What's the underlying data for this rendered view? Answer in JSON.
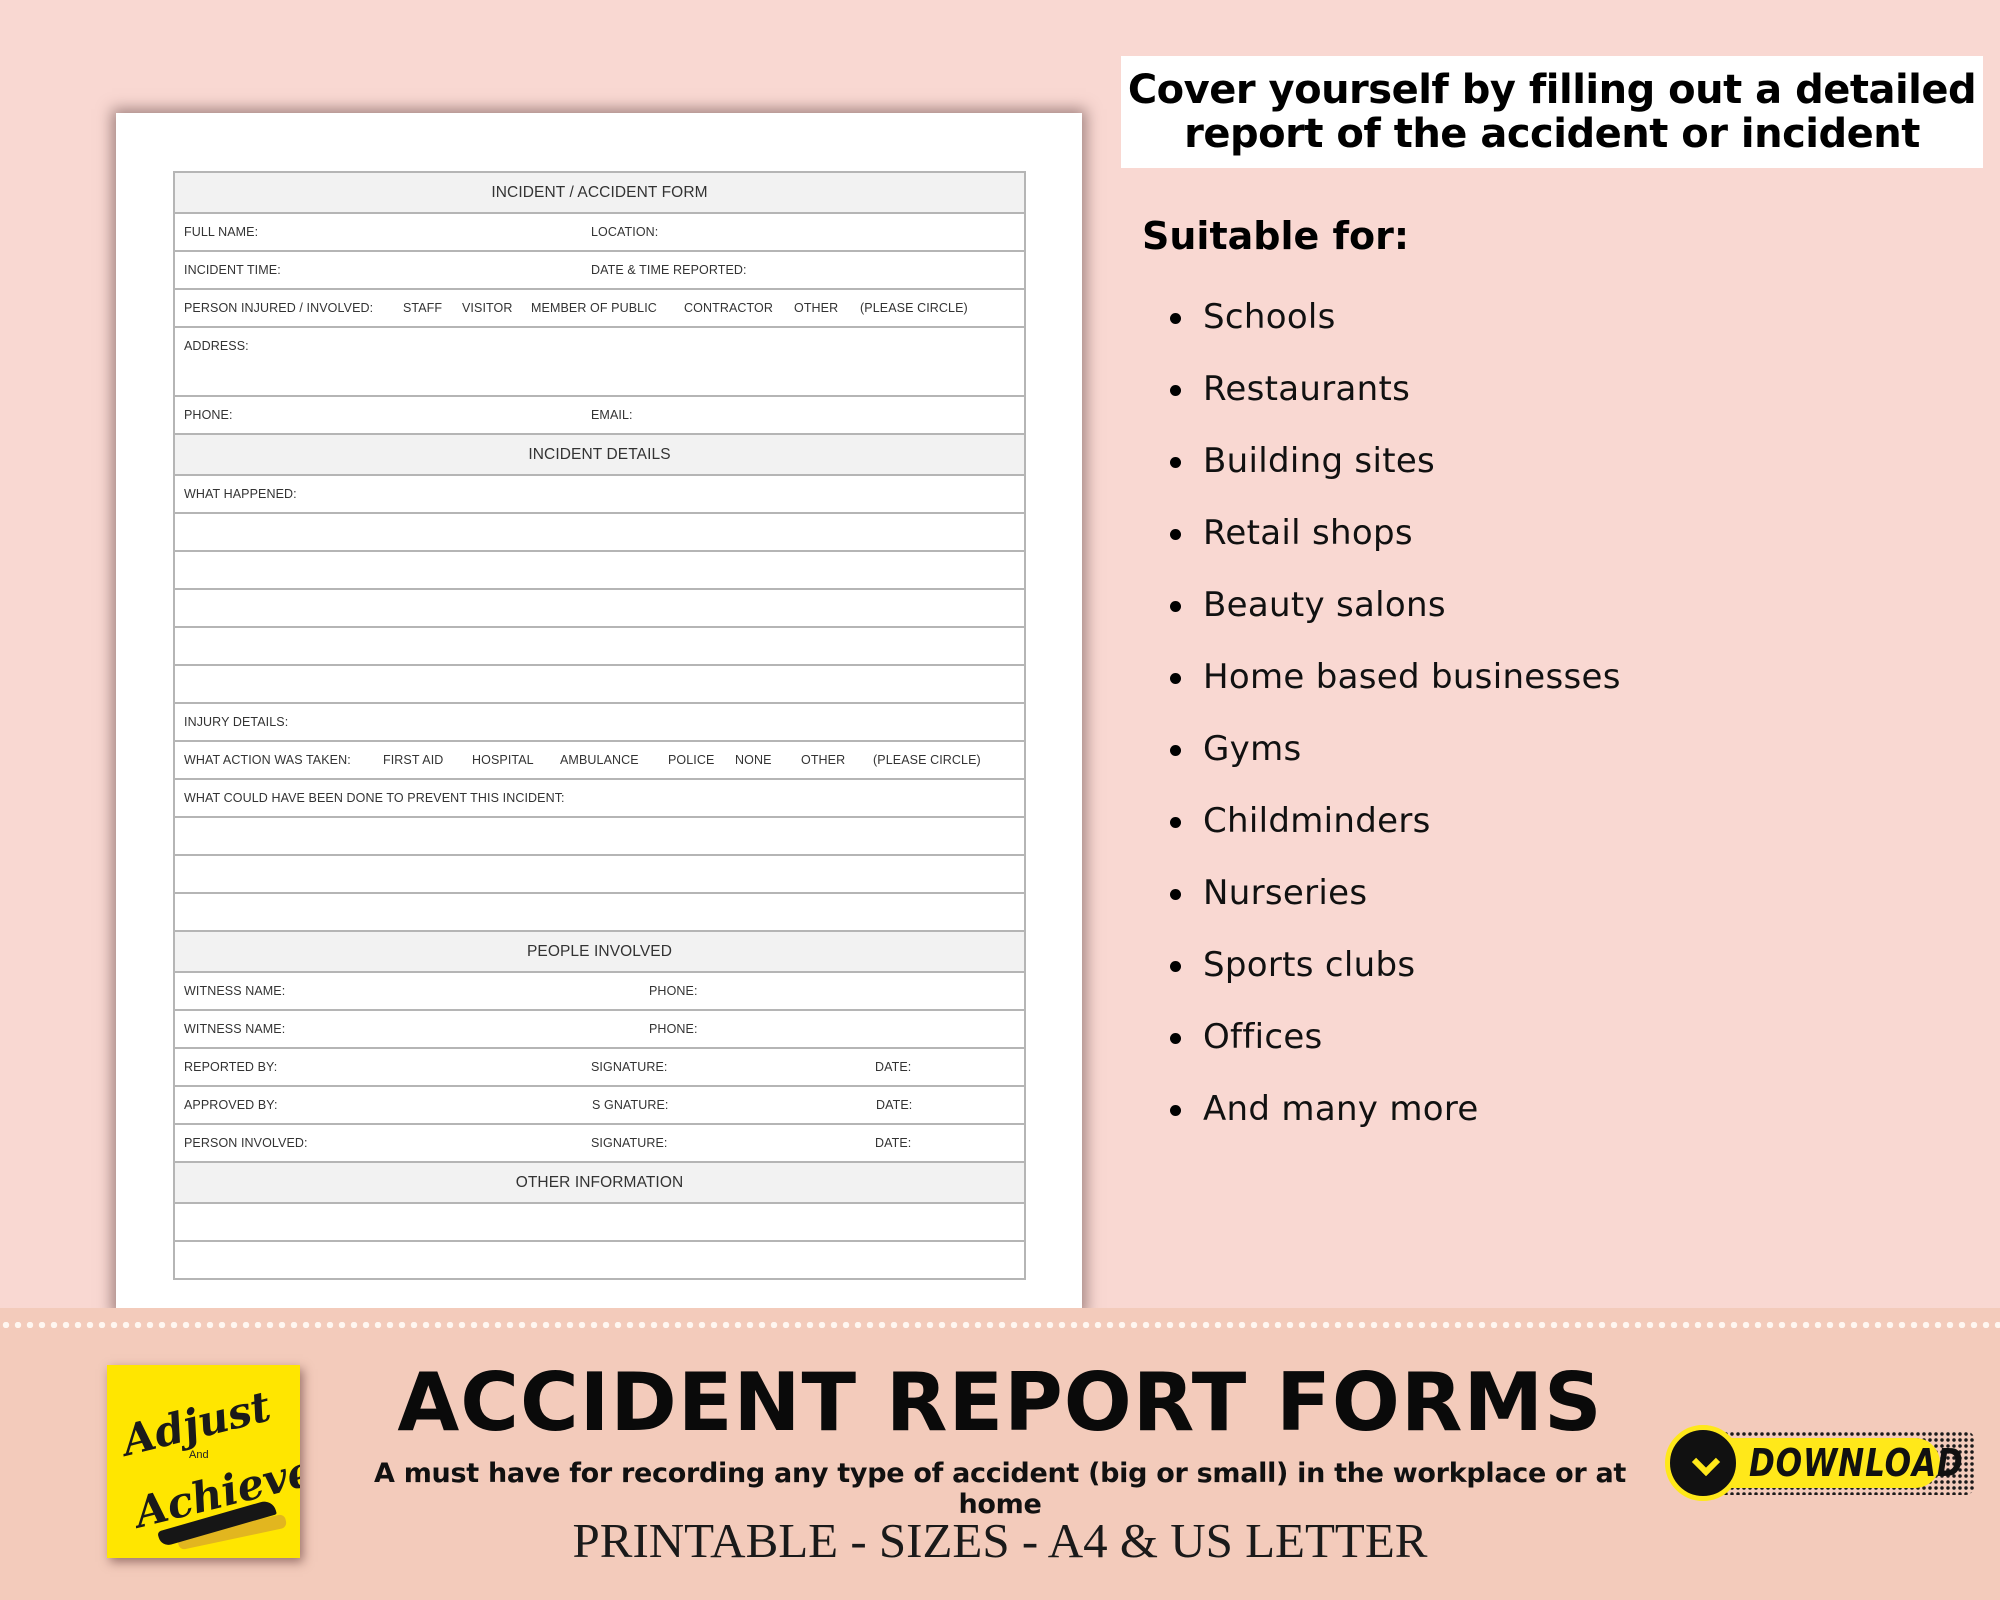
{
  "form": {
    "title": "INCIDENT / ACCIDENT FORM",
    "full_name_label": "FULL NAME:",
    "location_label": "LOCATION:",
    "incident_time_label": "INCIDENT TIME:",
    "date_time_reported_label": "DATE & TIME REPORTED:",
    "person_injured_label": "PERSON INJURED / INVOLVED:",
    "person_options": [
      "STAFF",
      "VISITOR",
      "MEMBER OF PUBLIC",
      "CONTRACTOR",
      "OTHER",
      "(PLEASE CIRCLE)"
    ],
    "address_label": "ADDRESS:",
    "phone_label": "PHONE:",
    "email_label": "EMAIL:",
    "incident_details_header": "INCIDENT DETAILS",
    "what_happened_label": "WHAT HAPPENED:",
    "injury_details_label": "INJURY DETAILS:",
    "action_taken_label": "WHAT ACTION WAS TAKEN:",
    "action_options": [
      "FIRST AID",
      "HOSPITAL",
      "AMBULANCE",
      "POLICE",
      "NONE",
      "OTHER",
      "(PLEASE CIRCLE)"
    ],
    "prevent_label": "WHAT COULD HAVE BEEN DONE TO PREVENT THIS INCIDENT:",
    "people_involved_header": "PEOPLE INVOLVED",
    "witness_name_label": "WITNESS NAME:",
    "witness_phone_label": "PHONE:",
    "reported_by_label": "REPORTED BY:",
    "approved_by_label": "APPROVED BY:",
    "person_involved_label": "PERSON INVOLVED:",
    "signature_label": "SIGNATURE:",
    "signature_label_approved": "S GNATURE:",
    "date_label": "DATE:",
    "other_information_header": "OTHER INFORMATION"
  },
  "tagline": {
    "line1": "Cover yourself by filling out a detailed",
    "line2": "report of the accident or incident"
  },
  "suitable": {
    "title": "Suitable for:",
    "items": [
      "Schools",
      "Restaurants",
      "Building sites",
      "Retail shops",
      "Beauty salons",
      "Home based businesses",
      "Gyms",
      "Childminders",
      "Nurseries",
      "Sports clubs",
      "Offices",
      "And many more"
    ]
  },
  "banner": {
    "title": "ACCIDENT REPORT FORMS",
    "subtitle": "A must have for recording any type of accident (big or small) in the workplace or at home",
    "sizes": "PRINTABLE - SIZES - A4 & US LETTER",
    "download_label": "DOWNLOAD",
    "logo": {
      "line1": "Adjust",
      "line2": "And",
      "line3": "Achieve"
    }
  },
  "colors": {
    "background": "#f9d8d2",
    "banner": "#f3cbbb",
    "logo_yellow": "#ffe600",
    "download_yellow": "#ffe81a",
    "form_header_gray": "#f2f2f2"
  }
}
